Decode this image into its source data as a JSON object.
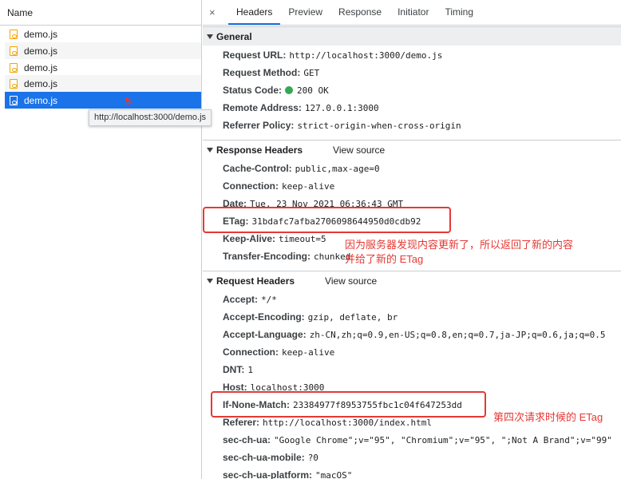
{
  "left_panel": {
    "header": "Name",
    "files": [
      {
        "name": "demo.js"
      },
      {
        "name": "demo.js"
      },
      {
        "name": "demo.js"
      },
      {
        "name": "demo.js"
      },
      {
        "name": "demo.js"
      }
    ],
    "annotation_number": "5",
    "tooltip": "http://localhost:3000/demo.js"
  },
  "tabs": {
    "close": "×",
    "items": [
      "Headers",
      "Preview",
      "Response",
      "Initiator",
      "Timing"
    ],
    "active": "Headers"
  },
  "general": {
    "title": "General",
    "request_url": {
      "key": "Request URL:",
      "value": "http://localhost:3000/demo.js"
    },
    "request_method": {
      "key": "Request Method:",
      "value": "GET"
    },
    "status_code": {
      "key": "Status Code:",
      "value": "200 OK",
      "status_color": "#34a853"
    },
    "remote_address": {
      "key": "Remote Address:",
      "value": "127.0.0.1:3000"
    },
    "referrer_policy": {
      "key": "Referrer Policy:",
      "value": "strict-origin-when-cross-origin"
    }
  },
  "response_headers": {
    "title": "Response Headers",
    "view_source": "View source",
    "items": [
      {
        "key": "Cache-Control:",
        "value": "public,max-age=0"
      },
      {
        "key": "Connection:",
        "value": "keep-alive"
      },
      {
        "key": "Date:",
        "value": "Tue, 23 Nov 2021 06:36:43 GMT"
      },
      {
        "key": "ETag:",
        "value": "31bdafc7afba2706098644950d0cdb92"
      },
      {
        "key": "Keep-Alive:",
        "value": "timeout=5"
      },
      {
        "key": "Transfer-Encoding:",
        "value": "chunked"
      }
    ]
  },
  "request_headers": {
    "title": "Request Headers",
    "view_source": "View source",
    "items": [
      {
        "key": "Accept:",
        "value": "*/*"
      },
      {
        "key": "Accept-Encoding:",
        "value": "gzip, deflate, br"
      },
      {
        "key": "Accept-Language:",
        "value": "zh-CN,zh;q=0.9,en-US;q=0.8,en;q=0.7,ja-JP;q=0.6,ja;q=0.5"
      },
      {
        "key": "Connection:",
        "value": "keep-alive"
      },
      {
        "key": "DNT:",
        "value": "1"
      },
      {
        "key": "Host:",
        "value": "localhost:3000"
      },
      {
        "key": "If-None-Match:",
        "value": "23384977f8953755fbc1c04f647253dd"
      },
      {
        "key": "Referer:",
        "value": "http://localhost:3000/index.html"
      },
      {
        "key": "sec-ch-ua:",
        "value": "\"Google Chrome\";v=\"95\", \"Chromium\";v=\"95\", \";Not A Brand\";v=\"99\""
      },
      {
        "key": "sec-ch-ua-mobile:",
        "value": "?0"
      },
      {
        "key": "sec-ch-ua-platform:",
        "value": "\"macOS\""
      }
    ]
  },
  "annotations": {
    "etag_note_line1": "因为服务器发现内容更新了，所以返回了新的内容",
    "etag_note_line2": "并给了新的 ETag",
    "if_none_match_note": "第四次请求时候的 ETag",
    "annotation_color": "#e53935"
  },
  "colors": {
    "accent": "#1a73e8",
    "selected_row": "#1a73e8",
    "section_bg": "#eceef0"
  }
}
